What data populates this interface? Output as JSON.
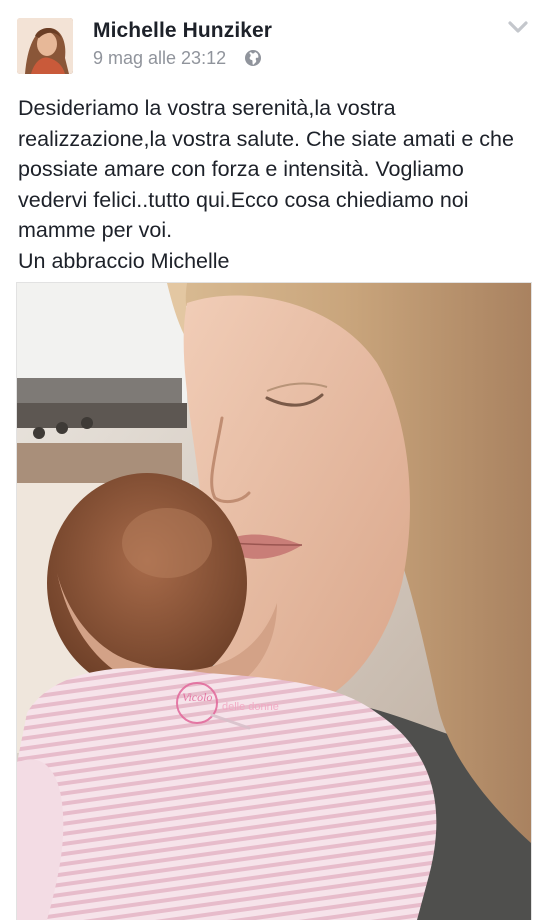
{
  "post": {
    "author": "Michelle Hunziker",
    "timestamp": "9 mag alle 23:12",
    "privacy_icon": "globe-icon",
    "menu_icon": "chevron-down-icon",
    "text_lines": [
      "Desideriamo la vostra serenità,la vostra realizzazione,la vostra salute. Che siate amati e che possiate amare con forza e intensità. Vogliamo vedervi felici..tutto qui.Ecco cosa chiediamo noi mamme per voi.",
      "Un abbraccio Michelle"
    ]
  },
  "colors": {
    "text": "#1d2129",
    "meta": "#90949c",
    "watermark": "#e2679a"
  }
}
